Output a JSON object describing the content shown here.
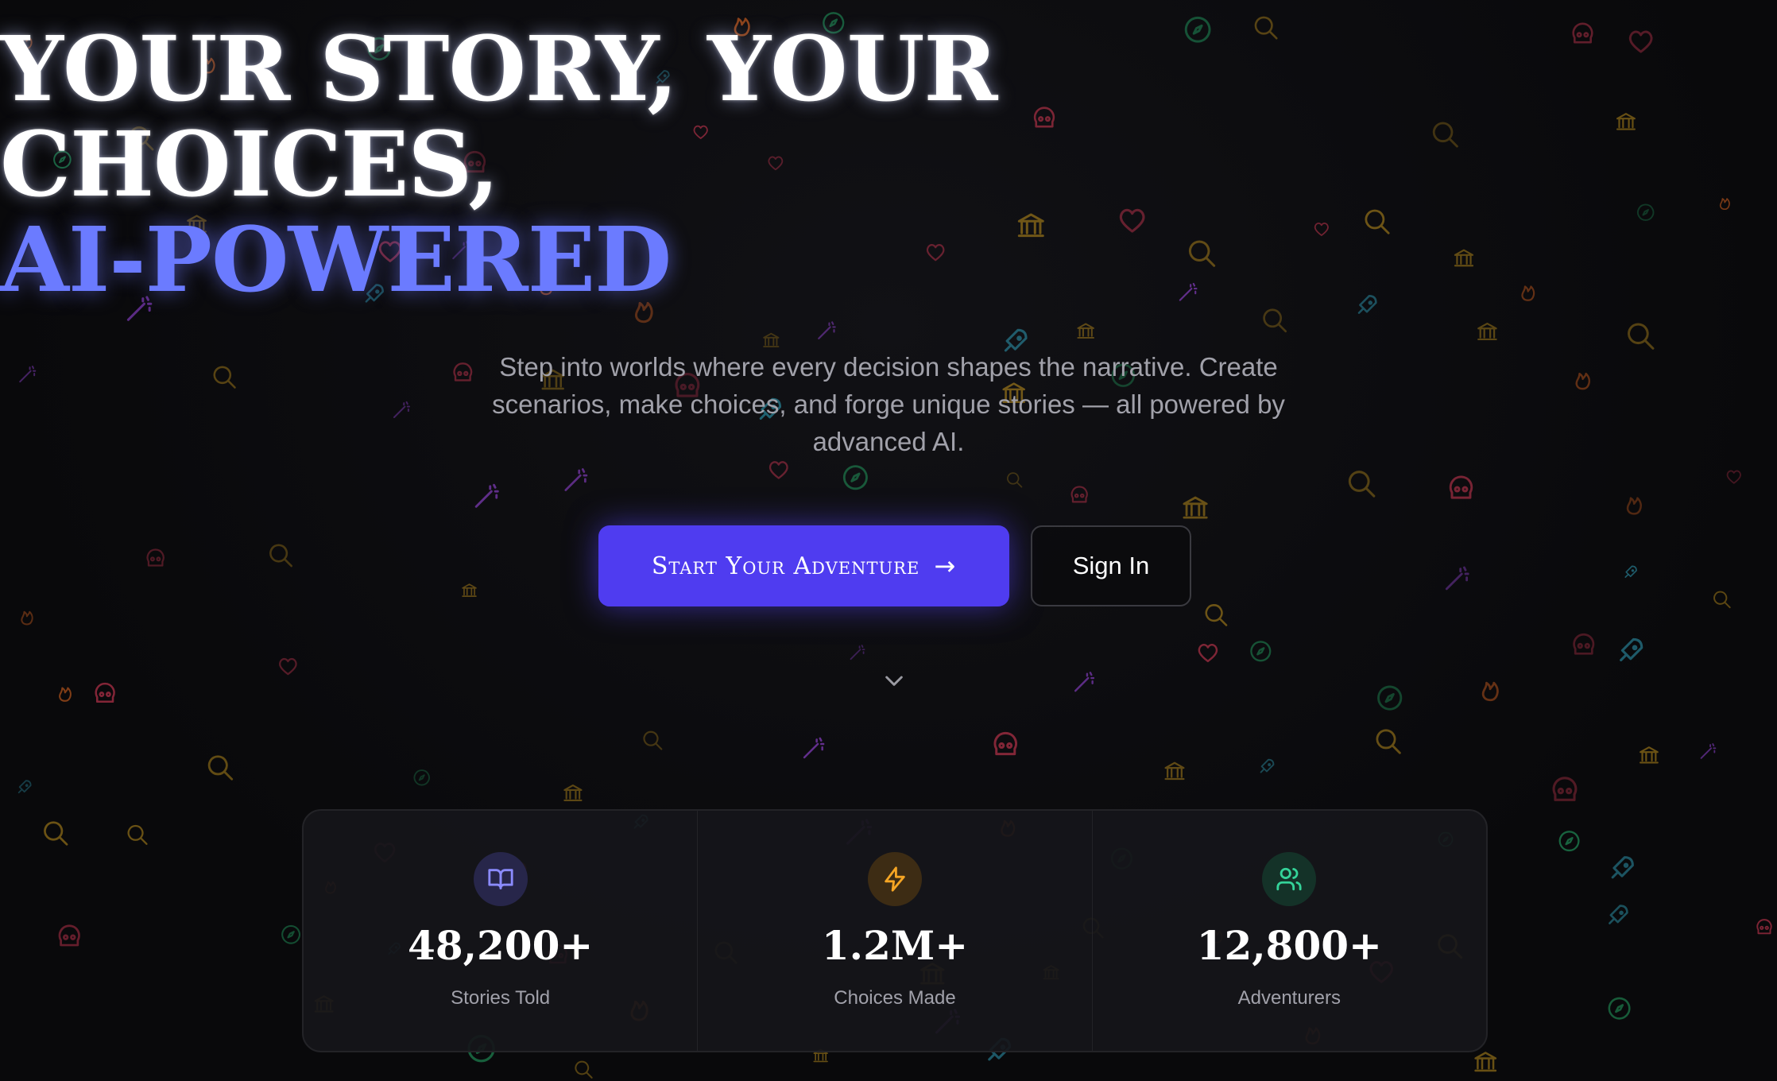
{
  "hero": {
    "headline_line1": "YOUR STORY, YOUR",
    "headline_line2": "CHOICES,",
    "headline_accent": "AI-POWERED",
    "subtitle": "Step into worlds where every decision shapes the narrative. Create scenarios, make choices, and forge unique stories — all powered by advanced AI.",
    "primary_button": "Start Your Adventure",
    "secondary_button": "Sign In"
  },
  "stats": [
    {
      "value": "48,200+",
      "label": "Stories Told",
      "icon": "book-open-icon",
      "color": "#8b8bff",
      "bg": "#27264a"
    },
    {
      "value": "1.2M+",
      "label": "Choices Made",
      "icon": "lightning-icon",
      "color": "#f5a524",
      "bg": "#3d2c14"
    },
    {
      "value": "12,800+",
      "label": "Adventurers",
      "icon": "users-icon",
      "color": "#34d399",
      "bg": "#143228"
    }
  ],
  "background": {
    "icon_names": [
      "temple-icon",
      "compass-icon",
      "magic-wand-icon",
      "heart-icon",
      "flame-icon",
      "skull-icon",
      "search-icon",
      "rocket-icon"
    ],
    "icon_colors": {
      "temple": "#a07a1a",
      "compass": "#1f8a55",
      "wand": "#8a3fc8",
      "heart": "#b8324a",
      "flame": "#c45a1e",
      "skull": "#b8324a",
      "search": "#a07a1a",
      "rocket": "#2a8aa0"
    }
  }
}
